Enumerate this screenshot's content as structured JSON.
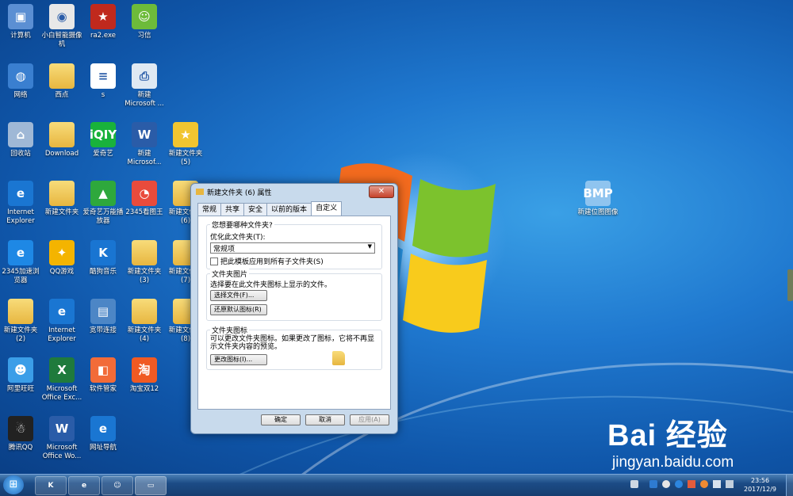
{
  "desktop_icons": [
    {
      "label": "计算机",
      "glyph": "▣",
      "color": "#5b8fd3"
    },
    {
      "label": "小白智能摄像机",
      "glyph": "◉",
      "color": "#e8e8e8"
    },
    {
      "label": "ra2.exe",
      "glyph": "★",
      "color": "#c0291d"
    },
    {
      "label": "习信",
      "glyph": "☺",
      "color": "#6dbb3a"
    },
    {
      "label": "网络",
      "glyph": "◍",
      "color": "#3a7fd0"
    },
    {
      "label": "西点",
      "glyph": "",
      "color": "folder"
    },
    {
      "label": "s",
      "glyph": "≡",
      "color": "#ffffff"
    },
    {
      "label": "新建 Microsoft ...",
      "glyph": "⎙",
      "color": "#dfe9f3"
    },
    {
      "label": "回收站",
      "glyph": "⌂",
      "color": "#9fb8d6"
    },
    {
      "label": "Download",
      "glyph": "",
      "color": "folder"
    },
    {
      "label": "爱奇艺",
      "glyph": "iQIY",
      "color": "#19b23b"
    },
    {
      "label": "新建 Microsof...",
      "glyph": "W",
      "color": "#2a5ca8"
    },
    {
      "label": "新建文件夹 (5)",
      "glyph": "★",
      "color": "#f1c530"
    },
    {
      "label": "Internet Explorer",
      "glyph": "e",
      "color": "#1a76d2"
    },
    {
      "label": "新建文件夹",
      "glyph": "",
      "color": "folder"
    },
    {
      "label": "爱奇艺万能播放器",
      "glyph": "▲",
      "color": "#2ea83c"
    },
    {
      "label": "2345看图王",
      "glyph": "◔",
      "color": "#e94b3c"
    },
    {
      "label": "新建文件夹 (6)",
      "glyph": "",
      "color": "folder"
    },
    {
      "label": "2345加速浏览器",
      "glyph": "e",
      "color": "#1e88e5"
    },
    {
      "label": "QQ游戏",
      "glyph": "✦",
      "color": "#f4b400"
    },
    {
      "label": "酷狗音乐",
      "glyph": "K",
      "color": "#1975d2"
    },
    {
      "label": "新建文件夹 (3)",
      "glyph": "",
      "color": "folder"
    },
    {
      "label": "新建文件夹 (7)",
      "glyph": "",
      "color": "folder"
    },
    {
      "label": "新建文件夹 (2)",
      "glyph": "",
      "color": "folder"
    },
    {
      "label": "Internet Explorer",
      "glyph": "e",
      "color": "#1a76d2"
    },
    {
      "label": "宽带连接",
      "glyph": "▤",
      "color": "#4c86c6"
    },
    {
      "label": "新建文件夹 (4)",
      "glyph": "",
      "color": "folder"
    },
    {
      "label": "新建文件夹 (8)",
      "glyph": "",
      "color": "folder"
    },
    {
      "label": "阿里旺旺",
      "glyph": "☻",
      "color": "#3b9ee8"
    },
    {
      "label": "Microsoft Office Exc...",
      "glyph": "X",
      "color": "#1f7a3c"
    },
    {
      "label": "软件管家",
      "glyph": "◧",
      "color": "#f26b38"
    },
    {
      "label": "淘宝双12",
      "glyph": "淘",
      "color": "#f05a23"
    },
    {
      "label": "腾讯QQ",
      "glyph": "☃",
      "color": "#222222"
    },
    {
      "label": "Microsoft Office Wo...",
      "glyph": "W",
      "color": "#2a5ca8"
    },
    {
      "label": "网址导航",
      "glyph": "e",
      "color": "#1a76d2"
    },
    {
      "label": "新建位图图像",
      "glyph": "BMP",
      "color": "#8fc4ef"
    }
  ],
  "dialog": {
    "title": "新建文件夹 (6) 属性",
    "close_label": "✕",
    "tabs": [
      "常规",
      "共享",
      "安全",
      "以前的版本",
      "自定义"
    ],
    "question": "您想要哪种文件夹?",
    "optimize_label": "优化此文件夹(T):",
    "optimize_value": "常规项",
    "apply_sub_label": "把此模板应用到所有子文件夹(S)",
    "pictures_title": "文件夹图片",
    "pictures_desc": "选择要在此文件夹图标上显示的文件。",
    "choose_file": "选择文件(F)...",
    "restore_default": "还原默认图标(R)",
    "icons_title": "文件夹图标",
    "icons_desc": "可以更改文件夹图标。如果更改了图标，它将不再显示文件夹内容的预览。",
    "change_icon": "更改图标(I)...",
    "ok": "确定",
    "cancel": "取消",
    "apply": "应用(A)"
  },
  "taskbar": {
    "start": "⊞",
    "pinned": [
      "K",
      "e",
      "☺",
      "▭"
    ],
    "time": "23:56",
    "date": "2017/12/9"
  },
  "watermark": {
    "brand": "Bai  经验",
    "url": "jingyan.baidu.com"
  }
}
